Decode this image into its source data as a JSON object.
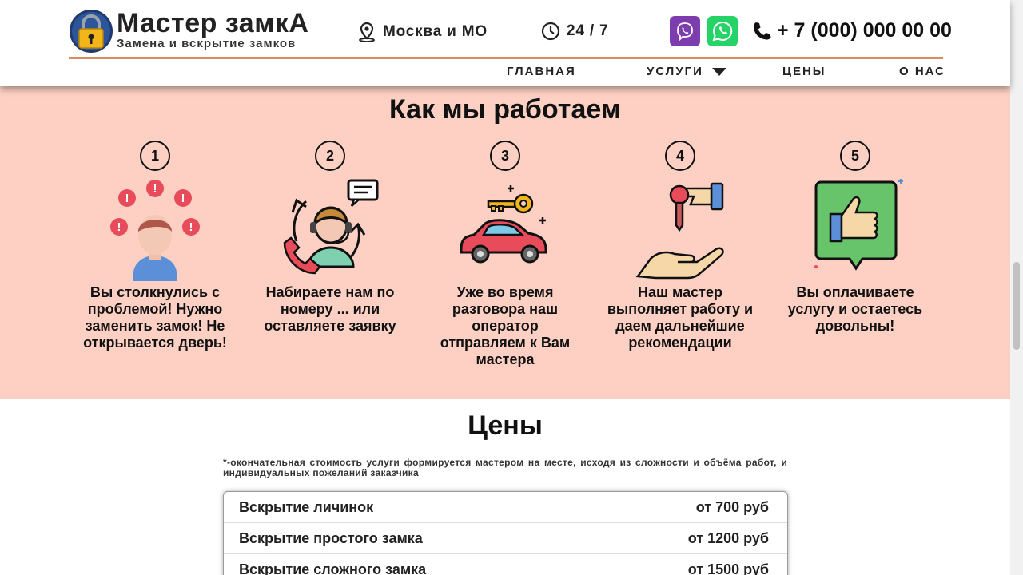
{
  "header": {
    "brand_title": "Мастер замкА",
    "brand_subtitle": "Замена и вскрытие замков",
    "location": "Москва и МО",
    "hours": "24 / 7",
    "phone": "+ 7 (000) 000 00 00",
    "icons": {
      "logo": "padlock-icon",
      "location": "location-pin-icon",
      "hours": "clock-icon",
      "viber": "viber-icon",
      "whatsapp": "whatsapp-icon",
      "phone": "phone-icon"
    }
  },
  "nav": {
    "items": [
      {
        "label": "ГЛАВНАЯ"
      },
      {
        "label": "УСЛУГИ",
        "has_dropdown": true
      },
      {
        "label": "ЦЕНЫ"
      },
      {
        "label": "О НАС"
      }
    ]
  },
  "how_we_work": {
    "title": "Как мы работаем",
    "steps": [
      {
        "number": "1",
        "text": "Вы столкнулись с проблемой! Нужно заменить замок! Не открывается дверь!",
        "icon": "worried-person-icon"
      },
      {
        "number": "2",
        "text": "Набираете нам по номеру ... или оставляете заявку",
        "icon": "operator-headset-icon"
      },
      {
        "number": "3",
        "text": "Уже во время разговора наш оператор отправляем к Вам мастера",
        "icon": "car-key-icon"
      },
      {
        "number": "4",
        "text": "Наш мастер выполняет работу и даем дальнейшие рекомендации",
        "icon": "hand-over-key-icon"
      },
      {
        "number": "5",
        "text": "Вы оплачиваете услугу и остаетесь довольны!",
        "icon": "thumbs-up-icon"
      }
    ]
  },
  "prices": {
    "title": "Цены",
    "note": "*-окончательная стоимость услуги формируется мастером на месте, исходя из сложности и объёма работ, и индивидуальных пожеланий заказчика",
    "rows": [
      {
        "service": "Вскрытие личинок",
        "price": "от 700 руб"
      },
      {
        "service": "Вскрытие простого замка",
        "price": "от 1200 руб"
      },
      {
        "service": "Вскрытие сложного замка",
        "price": "от 1500 руб"
      }
    ]
  },
  "colors": {
    "accent_line": "#d98b5f",
    "section_bg": "#fdd0c3",
    "viber": "#7d3daf",
    "whatsapp": "#25d366"
  }
}
